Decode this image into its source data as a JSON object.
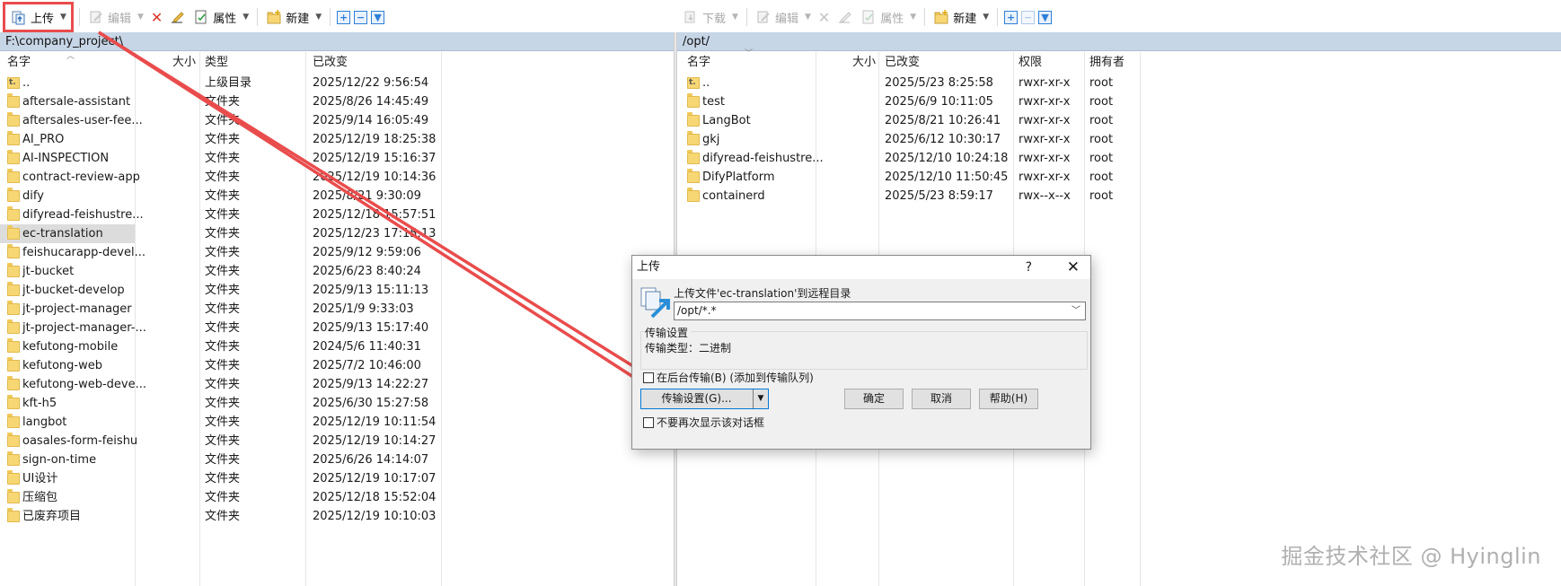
{
  "left_toolbar": {
    "upload_label": "上传",
    "edit_label": "编辑",
    "properties_label": "属性",
    "new_label": "新建"
  },
  "right_toolbar": {
    "download_label": "下载",
    "edit_label": "编辑",
    "properties_label": "属性",
    "new_label": "新建"
  },
  "left_pane": {
    "path": "F:\\company_project\\",
    "columns": {
      "name": "名字",
      "size": "大小",
      "type": "类型",
      "modified": "已改变"
    },
    "rows": [
      {
        "name": "..",
        "type": "上级目录",
        "modified": "2025/12/22 9:56:54",
        "updir": true
      },
      {
        "name": "aftersale-assistant",
        "type": "文件夹",
        "modified": "2025/8/26 14:45:49"
      },
      {
        "name": "aftersales-user-fee...",
        "type": "文件夹",
        "modified": "2025/9/14 16:05:49"
      },
      {
        "name": "AI_PRO",
        "type": "文件夹",
        "modified": "2025/12/19 18:25:38"
      },
      {
        "name": "AI-INSPECTION",
        "type": "文件夹",
        "modified": "2025/12/19 15:16:37"
      },
      {
        "name": "contract-review-app",
        "type": "文件夹",
        "modified": "2025/12/19 10:14:36"
      },
      {
        "name": "dify",
        "type": "文件夹",
        "modified": "2025/8/21 9:30:09"
      },
      {
        "name": "difyread-feishustre...",
        "type": "文件夹",
        "modified": "2025/12/18 15:57:51"
      },
      {
        "name": "ec-translation",
        "type": "文件夹",
        "modified": "2025/12/23 17:15:13",
        "selected": true
      },
      {
        "name": "feishucarapp-devel...",
        "type": "文件夹",
        "modified": "2025/9/12 9:59:06"
      },
      {
        "name": "jt-bucket",
        "type": "文件夹",
        "modified": "2025/6/23 8:40:24"
      },
      {
        "name": "jt-bucket-develop",
        "type": "文件夹",
        "modified": "2025/9/13 15:11:13"
      },
      {
        "name": "jt-project-manager",
        "type": "文件夹",
        "modified": "2025/1/9 9:33:03"
      },
      {
        "name": "jt-project-manager-...",
        "type": "文件夹",
        "modified": "2025/9/13 15:17:40"
      },
      {
        "name": "kefutong-mobile",
        "type": "文件夹",
        "modified": "2024/5/6 11:40:31"
      },
      {
        "name": "kefutong-web",
        "type": "文件夹",
        "modified": "2025/7/2 10:46:00"
      },
      {
        "name": "kefutong-web-deve...",
        "type": "文件夹",
        "modified": "2025/9/13 14:22:27"
      },
      {
        "name": "kft-h5",
        "type": "文件夹",
        "modified": "2025/6/30 15:27:58"
      },
      {
        "name": "langbot",
        "type": "文件夹",
        "modified": "2025/12/19 10:11:54"
      },
      {
        "name": "oasales-form-feishu",
        "type": "文件夹",
        "modified": "2025/12/19 10:14:27"
      },
      {
        "name": "sign-on-time",
        "type": "文件夹",
        "modified": "2025/6/26 14:14:07"
      },
      {
        "name": "UI设计",
        "type": "文件夹",
        "modified": "2025/12/19 10:17:07"
      },
      {
        "name": "压缩包",
        "type": "文件夹",
        "modified": "2025/12/18 15:52:04"
      },
      {
        "name": "已废弃项目",
        "type": "文件夹",
        "modified": "2025/12/19 10:10:03"
      }
    ]
  },
  "right_pane": {
    "path": "/opt/",
    "columns": {
      "name": "名字",
      "size": "大小",
      "modified": "已改变",
      "permissions": "权限",
      "owner": "拥有者"
    },
    "rows": [
      {
        "name": "..",
        "modified": "2025/5/23 8:25:58",
        "permissions": "rwxr-xr-x",
        "owner": "root",
        "updir": true
      },
      {
        "name": "test",
        "modified": "2025/6/9 10:11:05",
        "permissions": "rwxr-xr-x",
        "owner": "root"
      },
      {
        "name": "LangBot",
        "modified": "2025/8/21 10:26:41",
        "permissions": "rwxr-xr-x",
        "owner": "root"
      },
      {
        "name": "gkj",
        "modified": "2025/6/12 10:30:17",
        "permissions": "rwxr-xr-x",
        "owner": "root"
      },
      {
        "name": "difyread-feishustre...",
        "modified": "2025/12/10 10:24:18",
        "permissions": "rwxr-xr-x",
        "owner": "root"
      },
      {
        "name": "DifyPlatform",
        "modified": "2025/12/10 11:50:45",
        "permissions": "rwxr-xr-x",
        "owner": "root"
      },
      {
        "name": "containerd",
        "modified": "2025/5/23 8:59:17",
        "permissions": "rwx--x--x",
        "owner": "root"
      }
    ]
  },
  "dialog": {
    "title": "上传",
    "help_glyph": "?",
    "close_glyph": "✕",
    "message": "上传文件'ec-translation'到远程目录",
    "target_path": "/opt/*.*",
    "group_label": "传输设置",
    "transfer_type": "传输类型：二进制",
    "background_checkbox": "在后台传输(B) (添加到传输队列)",
    "transfer_settings_button": "传输设置(G)...",
    "ok_button": "确定",
    "cancel_button": "取消",
    "help_button": "帮助(H)",
    "dont_show_checkbox": "不要再次显示该对话框"
  },
  "watermark": "掘金技术社区 @ Hyinglin",
  "colors": {
    "path_bar": "#c7d6e6",
    "annotation_red": "#e94c4c",
    "folder_yellow": "#f7d774",
    "selection_gray": "#dcdcdc"
  }
}
